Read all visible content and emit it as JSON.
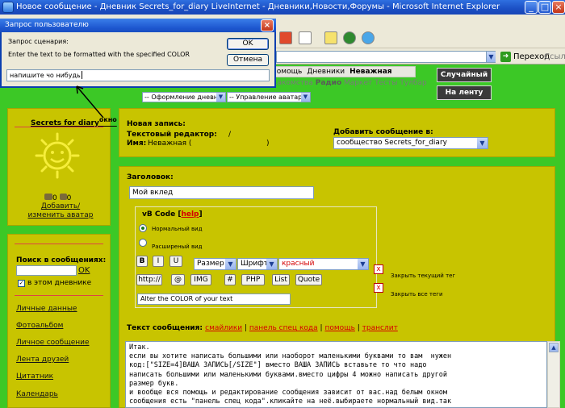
{
  "window": {
    "title": "Новое сообщение - Дневник Secrets_for_diary LiveInternet - Дневники,Новости,Форумы - Microsoft Internet Explorer"
  },
  "addressbar": {
    "go_label": "Переход",
    "links_label": "Ссылки"
  },
  "site": {
    "tabs": [
      "Помощь",
      "Дневники",
      "Неважная"
    ],
    "links": [
      "...акомства",
      "Радио",
      "Маркет",
      "Тесты",
      "Тулбар"
    ],
    "diary_design_select": "-- Оформление дневника",
    "avatars_select": "-- Управление аватарами",
    "random_button": "Случайный",
    "feed_button": "На ленту"
  },
  "sidebar": {
    "diary_name": "Secrets for diary",
    "diary_name_annotation": "окно",
    "change_avatar_icons": "0",
    "change_avatar_link": "Добавить/изменить аватар",
    "search_label": "Поиск в сообщениях:",
    "search_value": "",
    "search_ok": "OK",
    "search_scope_label": "в этом дневнике",
    "nav": [
      "Личные данные",
      "Фотоальбом",
      "Личное сообщение",
      "Лента друзей",
      "Цитатник",
      "Календарь"
    ]
  },
  "post_header": {
    "new_post_label": "Новая запись:",
    "editor_label": "Текстовый редактор:",
    "editor_value": "/",
    "name_label": "Имя:",
    "name_value": "Неважная (",
    "name_close": ")",
    "add_to_label": "Добавить сообщение в:",
    "add_to_value": "сообщество Secrets_for_diary"
  },
  "editor": {
    "title_label": "Заголовок:",
    "title_value": "Мой вклед",
    "bbcode_label": "vB Code",
    "help_label": "help",
    "mode_normal": "Нормальный вид",
    "mode_extended": "Расширеный вид",
    "buttons_row1": [
      "B",
      "I",
      "U"
    ],
    "size_select": "Размер",
    "font_select": "Шрифт",
    "color_select": "красный",
    "buttons_row2": [
      "http://",
      "@",
      "IMG",
      "#",
      "PHP",
      "List",
      "Quote"
    ],
    "close_current_tag": "Закрыть текущий тег",
    "close_all_tags": "Закрыть все теги",
    "hint_value": "Alter the COLOR of your text",
    "body_label": "Текст сообщения:",
    "body_links": [
      "смайлики",
      "панель спец кода",
      "помощь",
      "транслит"
    ],
    "body_text": "Итак.\nесли вы хотите написать большими или наоборот маленькими буквами то вам  нужен\nкод:[\"SIZE=4]ВАША ЗАПИСЬ[/SIZE\"] вместо ВАША ЗАПИСЬ вставьте то что надо\nнаписать большими или маленькими буквами.вместо цифры 4 можно написать другой\nразмер букв.\nи вообще вся помощь и редактирование сообщения зависит от вас.над белым окном\nсообщения есть \"панель спец кода\".кликайте на неё.выбираете нормальный вид.так"
  },
  "dialog": {
    "title": "Запрос пользователю",
    "prompt_label": "Запрос сценария:",
    "prompt_text": "Enter the text to be formatted with the specified COLOR",
    "ok_label": "OK",
    "cancel_label": "Отмена",
    "input_value": "напишите чо нибудь"
  }
}
